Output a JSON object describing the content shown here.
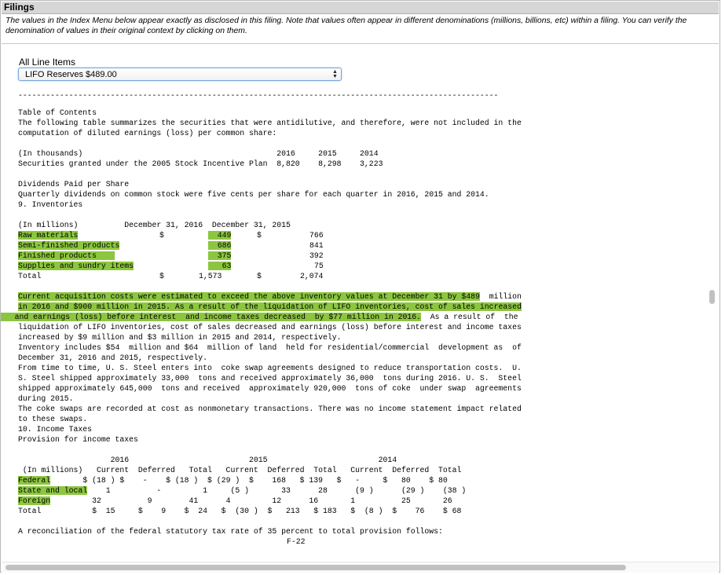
{
  "panel_title": "Filings",
  "notice": "The values in the Index Menu below appear exactly as disclosed in this filing. Note that values often appear in different denominations (millions, billions, etc) within a filing. You can verify the denomination of values in their original context by clicking on them.",
  "line_items_label": "All Line Items",
  "selected_item": "LIFO Reserves $489.00",
  "colors": {
    "highlight": "#8cc63f",
    "select_border": "#7aa7d9",
    "title_bar": "#d6d6d6"
  },
  "doc": {
    "rule": "--------------------------------------------------------------------------------------------------------",
    "toc": "Table of Contents",
    "intro1": "The following table summarizes the securities that were antidilutive, and therefore, were not included in the",
    "intro2": "computation of diluted earnings (loss) per common share:",
    "sec_hdr": "(In thousands)                                          2016     2015     2014",
    "sec_row": "Securities granted under the 2005 Stock Incentive Plan  8,820    8,298    3,223",
    "div_title": "Dividends Paid per Share",
    "div_text": "Quarterly dividends on common stock were five cents per share for each quarter in 2016, 2015 and 2014.",
    "inv_title": "9. Inventories",
    "inv_hdr": "(In millions)          December 31, 2016  December 31, 2015",
    "inv_rows": [
      {
        "label": "Raw materials",
        "pad": "     ",
        "sym": "$",
        "v2016": "449",
        "v2015": "766",
        "sym2": "$"
      },
      {
        "label": "Semi-finished products",
        "v2016": "686",
        "v2015": "841"
      },
      {
        "label": "Finished products",
        "v2016": "375",
        "v2015": "392"
      },
      {
        "label": "Supplies and sundry items",
        "v2016": "63",
        "v2015": "75"
      }
    ],
    "inv_total_label": "Total",
    "inv_total_2016": "1,573",
    "inv_total_2015": "2,074",
    "p1_l1a": "Current acquisition costs were estimated to exceed the above inventory values at December 31 by ",
    "p1_l1b": "$489",
    "p1_l1c": "  million",
    "p1_l2a": "in 2016 and $9",
    "p1_l2b": "00 million in 2015. ",
    "p1_l2c": "As a result of the liquidation of LIFO inventories, cost of sales increased",
    "p1_l3a": "and earnings (loss) before interest  and income taxes decreased  by $77 million in 2016.",
    "p1_l3b": "  As a result of  the",
    "p1_l4": "liquidation of LIFO inventories, cost of sales decreased and earnings (loss) before interest and income taxes",
    "p1_l5": "increased by $9 million and $3 million in 2015 and 2014, respectively.",
    "p2_l1": "Inventory includes $54  million and $64  million of land  held for residential/commercial  development as  of",
    "p2_l2": "December 31, 2016 and 2015, respectively.",
    "p3_l1": "From time to time, U. S. Steel enters into  coke swap agreements designed to reduce transportation costs.  U.",
    "p3_l2": "S. Steel shipped approximately 33,000  tons and received approximately 36,000  tons during 2016. U. S.  Steel",
    "p3_l3": "shipped approximately 645,000  tons and received  approximately 920,000  tons of coke  under swap  agreements",
    "p3_l4": "during 2015.",
    "p4_l1": "The coke swaps are recorded at cost as nonmonetary transactions. There was no income statement impact related",
    "p4_l2": "to these swaps.",
    "tax_title": "10. Income Taxes",
    "tax_sub": "Provision for income taxes",
    "tax_years": "                    2016                          2015                        2014",
    "tax_hdr": " (In millions)   Current  Deferred   Total   Current  Deferred  Total   Current  Deferred  Total",
    "tax_rows": [
      {
        "label": "Federal",
        "rest": " $ (18 ) $    -    $ (18 )  $ (29 )  $    168   $ 139   $   -     $   80    $ 80"
      },
      {
        "label": "State and local",
        "rest": "    1          -         1     (5 )       33      28      (9 )      (29 )    (38 )"
      },
      {
        "label": "Foreign",
        "rest": "   32          9        41      4         12      16       1          25       26"
      }
    ],
    "tax_total": "Total           $  15     $    9    $  24   $  (30 )  $   213   $ 183   $  (8 )  $    76    $ 68",
    "recon": "A reconciliation of the federal statutory tax rate of 35 percent to total provision follows:",
    "page_no": "F-22"
  }
}
